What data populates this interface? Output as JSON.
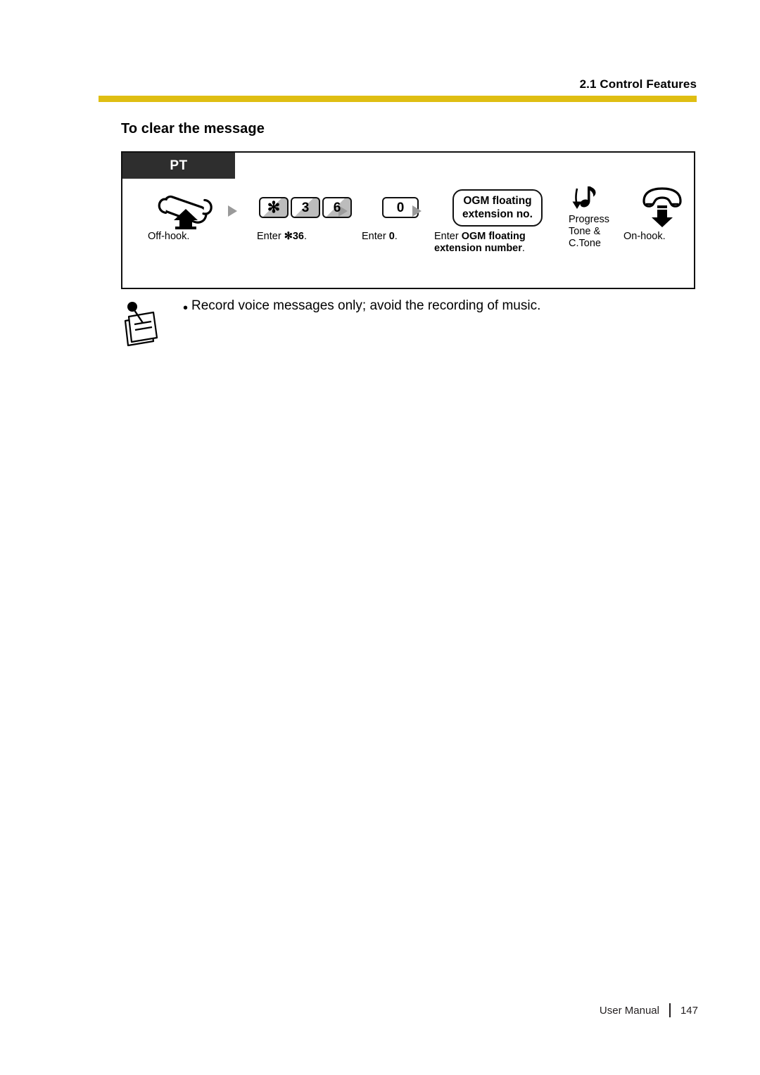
{
  "header": {
    "title": "2.1 Control Features",
    "rule_color": "#DFBE12"
  },
  "section": {
    "heading": "To clear the message"
  },
  "diagram": {
    "tab_label": "PT",
    "steps": [
      {
        "id": "off-hook",
        "icon": "handset-offhook-icon",
        "caption": "Off-hook."
      },
      {
        "id": "enter-star-36",
        "keys": [
          "✻",
          "3",
          "6"
        ],
        "caption_prefix": "Enter ",
        "caption_bold": "✻36",
        "caption_suffix": "."
      },
      {
        "id": "enter-0",
        "keys": [
          "0"
        ],
        "caption_prefix": "Enter ",
        "caption_bold": "0",
        "caption_suffix": "."
      },
      {
        "id": "ogm-floating-extension",
        "box_line1": "OGM floating",
        "box_line2": "extension no.",
        "caption_prefix": "Enter ",
        "caption_bold1": "OGM floating",
        "caption_bold2": "extension number",
        "caption_suffix": "."
      },
      {
        "id": "progress-tone",
        "icon": "music-note-down-arrow-icon",
        "label_line1": "Progress",
        "label_line2": "Tone &",
        "label_line3": "C.Tone"
      },
      {
        "id": "on-hook",
        "icon": "handset-onhook-icon",
        "caption": "On-hook."
      }
    ]
  },
  "note": {
    "icon": "memo-note-icon",
    "bullet": "•",
    "text": "Record voice messages only; avoid the recording of music."
  },
  "footer": {
    "label": "User Manual",
    "page_number": "147"
  }
}
